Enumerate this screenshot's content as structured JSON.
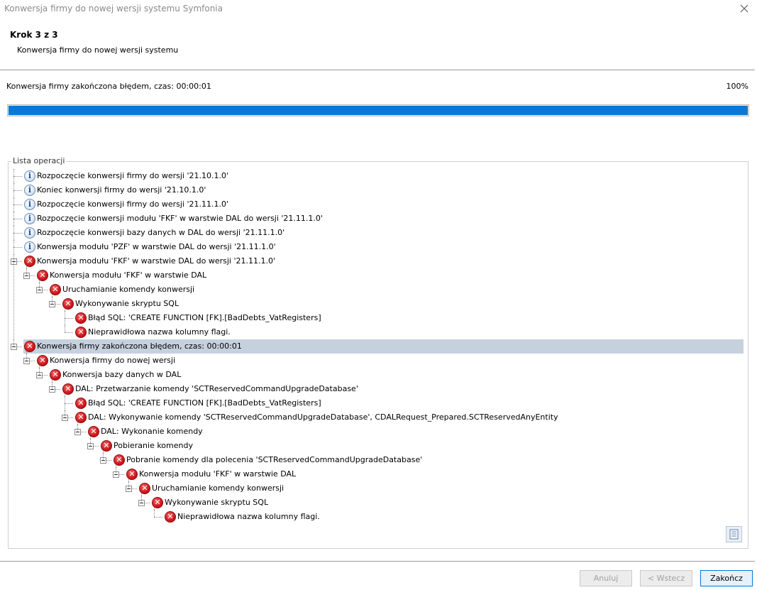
{
  "window": {
    "title": "Konwersja firmy do nowej wersji systemu Symfonia",
    "close_icon": "close-icon"
  },
  "step": {
    "title": "Krok 3 z 3",
    "subtitle": "Konwersja firmy do nowej wersji systemu"
  },
  "status": {
    "text": "Konwersja firmy zakończona błędem, czas: 00:00:01",
    "percent_label": "100%",
    "progress": 1.0,
    "progress_color": "#0a78d4"
  },
  "operations": {
    "label": "Lista operacji",
    "items": [
      {
        "level": 0,
        "icon": "info",
        "text": "Rozpoczęcie konwersji firmy do wersji '21.10.1.0'"
      },
      {
        "level": 0,
        "icon": "info",
        "text": "Koniec konwersji firmy do wersji '21.10.1.0'"
      },
      {
        "level": 0,
        "icon": "info",
        "text": "Rozpoczęcie konwersji firmy do wersji '21.11.1.0'"
      },
      {
        "level": 0,
        "icon": "info",
        "text": "Rozpoczęcie konwersji modułu 'FKF' w warstwie DAL do wersji '21.11.1.0'"
      },
      {
        "level": 0,
        "icon": "info",
        "text": "Rozpoczęcie konwersji bazy danych w DAL do wersji '21.11.1.0'"
      },
      {
        "level": 0,
        "icon": "info",
        "text": "Konwersja modułu 'PZF' w warstwie DAL do wersji '21.11.1.0'"
      },
      {
        "level": 0,
        "icon": "error",
        "text": "Konwersja modułu 'FKF' w warstwie DAL do wersji '21.11.1.0'",
        "expanded": true
      },
      {
        "level": 1,
        "icon": "error",
        "text": "Konwersja modułu 'FKF' w warstwie DAL",
        "expanded": true
      },
      {
        "level": 2,
        "icon": "error",
        "text": "Uruchamianie komendy konwersji",
        "expanded": true
      },
      {
        "level": 3,
        "icon": "error",
        "text": "Wykonywanie skryptu SQL",
        "expanded": true
      },
      {
        "level": 4,
        "icon": "error",
        "text": "Błąd SQL: 'CREATE FUNCTION [FK].[BadDebts_VatRegisters]"
      },
      {
        "level": 4,
        "icon": "error",
        "text": "Nieprawidłowa nazwa kolumny flagi."
      },
      {
        "level": 0,
        "icon": "error",
        "text": "Konwersja firmy zakończona błędem, czas: 00:00:01",
        "expanded": true,
        "selected": true
      },
      {
        "level": 1,
        "icon": "error",
        "text": "Konwersja firmy do nowej wersji",
        "expanded": true
      },
      {
        "level": 2,
        "icon": "error",
        "text": "Konwersja bazy danych w DAL",
        "expanded": true
      },
      {
        "level": 3,
        "icon": "error",
        "text": "DAL: Przetwarzanie komendy 'SCTReservedCommandUpgradeDatabase'",
        "expanded": true
      },
      {
        "level": 4,
        "icon": "error",
        "text": "Błąd SQL: 'CREATE FUNCTION [FK].[BadDebts_VatRegisters]"
      },
      {
        "level": 4,
        "icon": "error",
        "text": "DAL: Wykonywanie komendy 'SCTReservedCommandUpgradeDatabase', CDALRequest_Prepared.SCTReservedAnyEntity",
        "expanded": true
      },
      {
        "level": 5,
        "icon": "error",
        "text": "DAL: Wykonanie komendy",
        "expanded": true
      },
      {
        "level": 6,
        "icon": "error",
        "text": "Pobieranie komendy",
        "expanded": true
      },
      {
        "level": 7,
        "icon": "error",
        "text": "Pobranie komendy dla polecenia 'SCTReservedCommandUpgradeDatabase'",
        "expanded": true
      },
      {
        "level": 8,
        "icon": "error",
        "text": "Konwersja modułu 'FKF' w warstwie DAL",
        "expanded": true
      },
      {
        "level": 9,
        "icon": "error",
        "text": "Uruchamianie komendy konwersji",
        "expanded": true
      },
      {
        "level": 10,
        "icon": "error",
        "text": "Wykonywanie skryptu SQL",
        "expanded": true
      },
      {
        "level": 11,
        "icon": "error",
        "text": "Nieprawidłowa nazwa kolumny flagi."
      }
    ]
  },
  "corner_icon": "list-view-icon",
  "buttons": {
    "cancel": "Anuluj",
    "back": "< Wstecz",
    "finish": "Zakończ"
  }
}
